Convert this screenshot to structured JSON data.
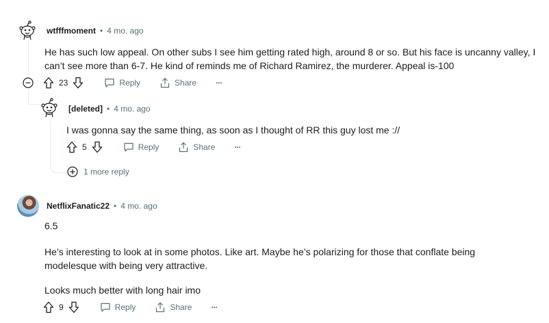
{
  "comments": [
    {
      "username": "wtfffmoment",
      "age": "4 mo. ago",
      "body_lines": [
        "He has such low appeal. On other subs I see him getting rated high, around 8 or so. But his face is uncanny valley, I",
        "can’t see more than 6-7. He kind of reminds me of Richard Ramirez, the murderer. Appeal is-100"
      ],
      "votes": "23",
      "reply_label": "Reply",
      "share_label": "Share",
      "more_label": "···"
    },
    {
      "username": "[deleted]",
      "age": "4 mo. ago",
      "body_lines": [
        "I was gonna say the same thing, as soon as I thought of RR this guy lost me ://"
      ],
      "votes": "5",
      "reply_label": "Reply",
      "share_label": "Share",
      "more_label": "···"
    },
    {
      "username": "NetflixFanatic22",
      "age": "4 mo. ago",
      "paragraphs": [
        "6.5",
        "He’s interesting to look at in some photos. Like art. Maybe he’s polarizing for those that conflate being",
        "modelesque with being very attractive.",
        "Looks much better with long hair imo"
      ],
      "votes": "9",
      "reply_label": "Reply",
      "share_label": "Share",
      "more_label": "···"
    }
  ],
  "more_replies_label": "1 more reply",
  "separator": "•",
  "colors": {
    "text": "#1c1c1c",
    "meta": "#576f76",
    "thread_line": "#e5ebee"
  },
  "icons": [
    "snoo-avatar-icon",
    "collapse-minus-icon",
    "upvote-icon",
    "downvote-icon",
    "reply-icon",
    "share-icon",
    "more-dots-icon",
    "expand-plus-icon"
  ]
}
